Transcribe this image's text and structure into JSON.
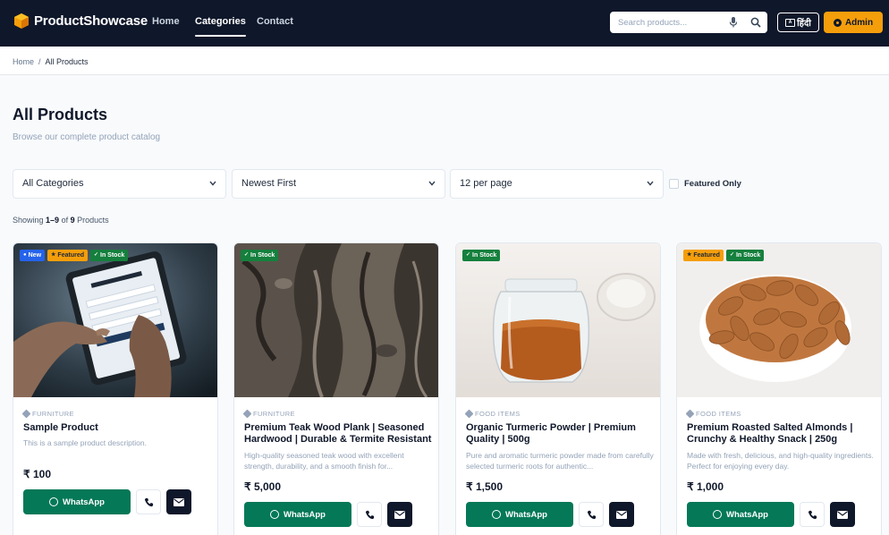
{
  "nav": {
    "brand": "ProductShowcase",
    "links": [
      "Home",
      "Categories",
      "Contact"
    ],
    "active_link": "Categories",
    "search_placeholder": "Search products...",
    "lang_label": "हिंदी",
    "admin_label": "Admin"
  },
  "breadcrumb": {
    "home": "Home",
    "separator": "/",
    "current": "All Products"
  },
  "page": {
    "title": "All Products",
    "subtitle": "Browse our complete product catalog"
  },
  "filters": {
    "category": "All Categories",
    "sort": "Newest First",
    "per_page": "12 per page",
    "featured_label": "Featured Only",
    "featured_checked": false
  },
  "showing": {
    "prefix": "Showing",
    "range": "1–9",
    "of": "of",
    "total": "9",
    "suffix": "Products"
  },
  "products": [
    {
      "badges": [
        {
          "label": "New",
          "type": "new"
        },
        {
          "label": "Featured",
          "type": "featured"
        },
        {
          "label": "In Stock",
          "type": "stock"
        }
      ],
      "category": "FURNITURE",
      "name": "Sample Product",
      "description": "This is a sample product description.",
      "price": "₹ 100",
      "whatsapp_label": "WhatsApp",
      "image": "tablet-signup-photo"
    },
    {
      "badges": [
        {
          "label": "In Stock",
          "type": "stock"
        }
      ],
      "category": "FURNITURE",
      "name": "Premium Teak Wood Plank | Seasoned Hardwood | Durable & Termite Resistant",
      "description": "High-quality seasoned teak wood with excellent strength, durability, and a smooth finish for...",
      "price": "₹ 5,000",
      "whatsapp_label": "WhatsApp",
      "image": "bark-texture-photo"
    },
    {
      "badges": [
        {
          "label": "In Stock",
          "type": "stock"
        }
      ],
      "category": "FOOD ITEMS",
      "name": "Organic Turmeric Powder | Premium Quality | 500g",
      "description": "Pure and aromatic turmeric powder made from carefully selected turmeric roots for authentic...",
      "price": "₹ 1,500",
      "whatsapp_label": "WhatsApp",
      "image": "spice-jar-photo"
    },
    {
      "badges": [
        {
          "label": "Featured",
          "type": "featured"
        },
        {
          "label": "In Stock",
          "type": "stock"
        }
      ],
      "category": "FOOD ITEMS",
      "name": "Premium Roasted Salted Almonds | Crunchy & Healthy Snack | 250g",
      "description": "Made with fresh, delicious, and high-quality ingredients. Perfect for enjoying every day.",
      "price": "₹ 1,000",
      "whatsapp_label": "WhatsApp",
      "image": "almond-bowl-photo"
    }
  ],
  "colors": {
    "nav_bg": "#0f172a",
    "accent": "#f59e0b",
    "whatsapp": "#047857",
    "in_stock": "#15803d",
    "new": "#2563eb"
  }
}
